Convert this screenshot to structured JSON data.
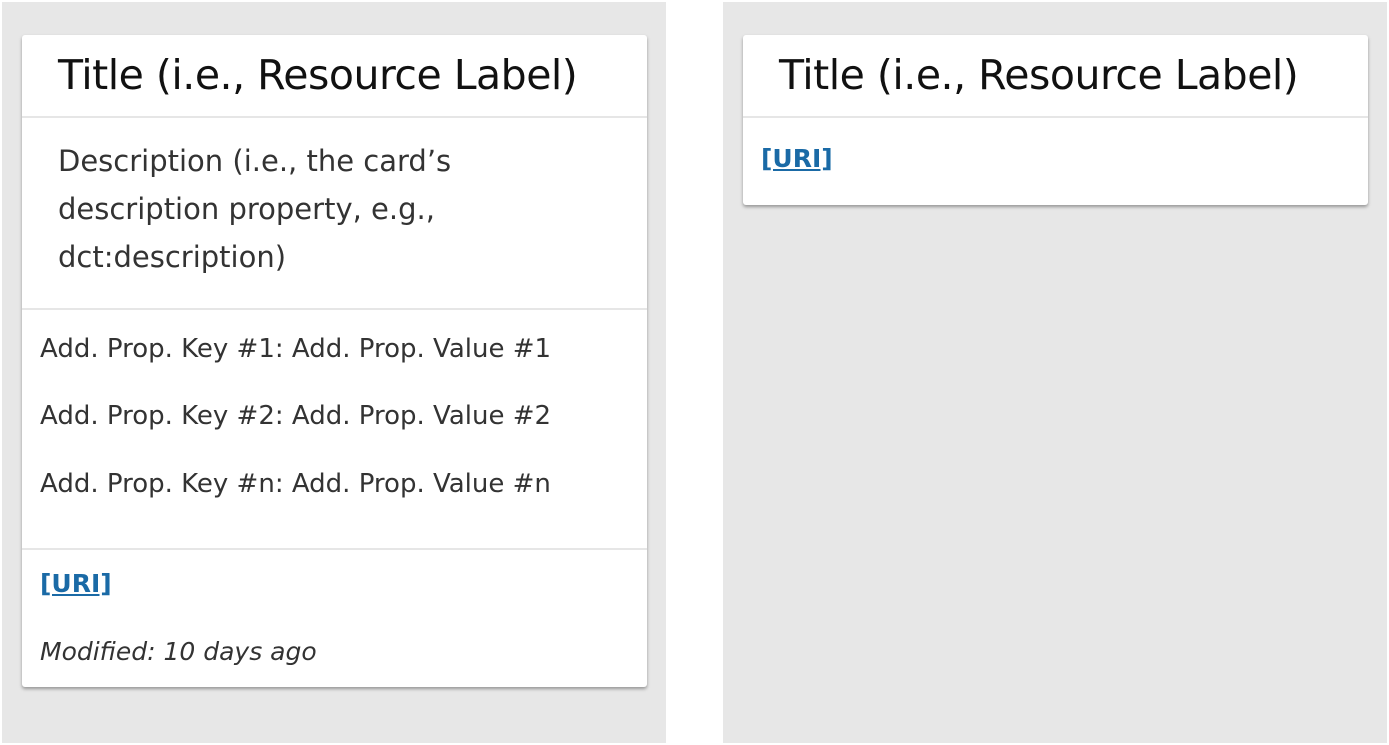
{
  "card_full": {
    "title": "Title (i.e., Resource Label)",
    "description": "Description (i.e., the card’s description property, e.g., dct:description)",
    "properties": [
      "Add. Prop. Key #1: Add. Prop. Value #1",
      "Add. Prop. Key #2: Add. Prop. Value #2",
      "Add. Prop. Key #n: Add. Prop. Value #n"
    ],
    "uri_label": "[URI]",
    "modified": "Modified: 10 days ago"
  },
  "card_compact": {
    "title": "Title (i.e., Resource Label)",
    "uri_label": "[URI]"
  },
  "colors": {
    "background": "#e7e7e7",
    "card": "#ffffff",
    "link": "#1a6aa6",
    "divider": "#e6e6e6"
  }
}
